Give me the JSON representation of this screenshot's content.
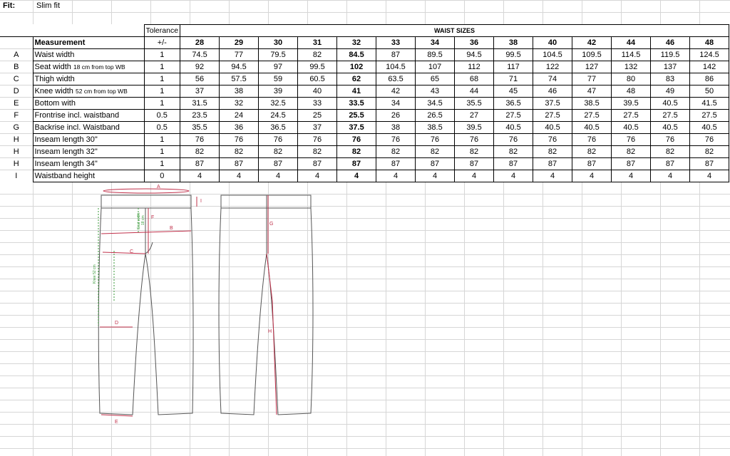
{
  "header": {
    "fit_label": "Fit:",
    "fit_value": "Slim fit"
  },
  "table": {
    "tolerance_header": "Tolerance",
    "tolerance_sub": "+/-",
    "measurement_header": "Measurement",
    "sizes_header": "WAIST SIZES",
    "sizes": [
      "28",
      "29",
      "30",
      "31",
      "32",
      "33",
      "34",
      "36",
      "38",
      "40",
      "42",
      "44",
      "46",
      "48"
    ],
    "sample_size_index": 4,
    "rows": [
      {
        "code": "A",
        "name": "Waist width",
        "note": "",
        "tol": "1",
        "values": [
          "74.5",
          "77",
          "79.5",
          "82",
          "84.5",
          "87",
          "89.5",
          "94.5",
          "99.5",
          "104.5",
          "109.5",
          "114.5",
          "119.5",
          "124.5"
        ]
      },
      {
        "code": "B",
        "name": "Seat width",
        "note": "18 cm from top WB",
        "tol": "1",
        "values": [
          "92",
          "94.5",
          "97",
          "99.5",
          "102",
          "104.5",
          "107",
          "112",
          "117",
          "122",
          "127",
          "132",
          "137",
          "142"
        ]
      },
      {
        "code": "C",
        "name": "Thigh width",
        "note": "",
        "tol": "1",
        "values": [
          "56",
          "57.5",
          "59",
          "60.5",
          "62",
          "63.5",
          "65",
          "68",
          "71",
          "74",
          "77",
          "80",
          "83",
          "86"
        ]
      },
      {
        "code": "D",
        "name": "Knee width",
        "note": "52 cm from top WB",
        "tol": "1",
        "values": [
          "37",
          "38",
          "39",
          "40",
          "41",
          "42",
          "43",
          "44",
          "45",
          "46",
          "47",
          "48",
          "49",
          "50"
        ]
      },
      {
        "code": "E",
        "name": "Bottom with",
        "note": "",
        "tol": "1",
        "values": [
          "31.5",
          "32",
          "32.5",
          "33",
          "33.5",
          "34",
          "34.5",
          "35.5",
          "36.5",
          "37.5",
          "38.5",
          "39.5",
          "40.5",
          "41.5"
        ]
      },
      {
        "code": "F",
        "name": "Frontrise incl. waistband",
        "note": "",
        "tol": "0.5",
        "values": [
          "23.5",
          "24",
          "24.5",
          "25",
          "25.5",
          "26",
          "26.5",
          "27",
          "27.5",
          "27.5",
          "27.5",
          "27.5",
          "27.5",
          "27.5"
        ]
      },
      {
        "code": "G",
        "name": "Backrise incl. Waistband",
        "note": "",
        "tol": "0.5",
        "values": [
          "35.5",
          "36",
          "36.5",
          "37",
          "37.5",
          "38",
          "38.5",
          "39.5",
          "40.5",
          "40.5",
          "40.5",
          "40.5",
          "40.5",
          "40.5"
        ]
      },
      {
        "code": "H",
        "name": "Inseam length 30\"",
        "note": "",
        "tol": "1",
        "values": [
          "76",
          "76",
          "76",
          "76",
          "76",
          "76",
          "76",
          "76",
          "76",
          "76",
          "76",
          "76",
          "76",
          "76"
        ]
      },
      {
        "code": "H",
        "name": "Inseam length 32\"",
        "note": "",
        "tol": "1",
        "values": [
          "82",
          "82",
          "82",
          "82",
          "82",
          "82",
          "82",
          "82",
          "82",
          "82",
          "82",
          "82",
          "82",
          "82"
        ]
      },
      {
        "code": "H",
        "name": "Inseam length 34\"",
        "note": "",
        "tol": "1",
        "values": [
          "87",
          "87",
          "87",
          "87",
          "87",
          "87",
          "87",
          "87",
          "87",
          "87",
          "87",
          "87",
          "87",
          "87"
        ]
      },
      {
        "code": "I",
        "name": "Waistband height",
        "note": "",
        "tol": "0",
        "values": [
          "4",
          "4",
          "4",
          "4",
          "4",
          "4",
          "4",
          "4",
          "4",
          "4",
          "4",
          "4",
          "4",
          "4"
        ]
      }
    ]
  },
  "drawing": {
    "labels": {
      "a": "A",
      "b": "B",
      "c": "C",
      "d": "D",
      "e": "E",
      "f": "F",
      "g": "G",
      "h": "H",
      "i": "I"
    },
    "seat_note_1": "Seat width",
    "seat_note_2": "18 cm",
    "knee_note": "Knee 52 cm",
    "line_color": "#555555",
    "measure_color": "#c0304a",
    "note_color": "#3a9a3a"
  }
}
